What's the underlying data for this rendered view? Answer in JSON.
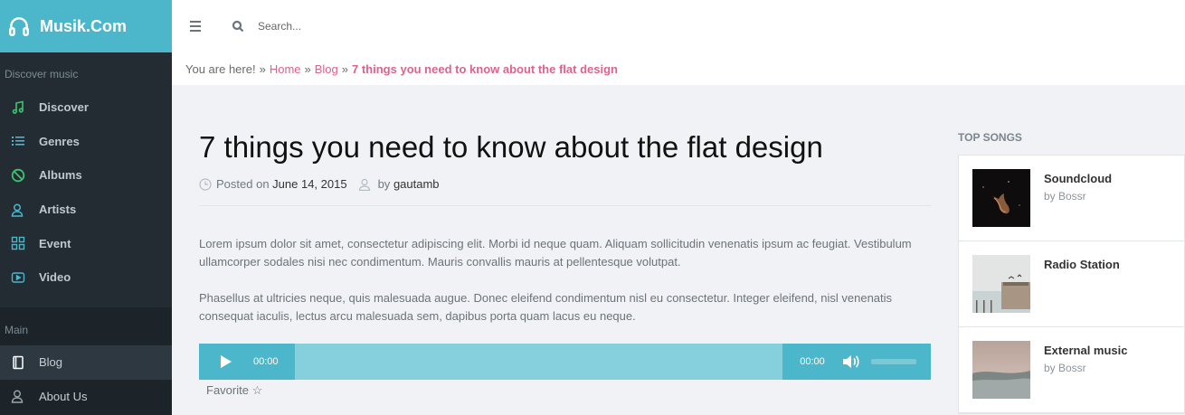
{
  "app": {
    "brand": "Musik.Com"
  },
  "sidebar": {
    "discover_label": "Discover music",
    "discover_items": [
      {
        "label": "Discover",
        "icon": "music-note-icon",
        "color": "#3bc46d"
      },
      {
        "label": "Genres",
        "icon": "list-icon",
        "color": "#4cb6cb"
      },
      {
        "label": "Albums",
        "icon": "disc-icon",
        "color": "#3bc46d"
      },
      {
        "label": "Artists",
        "icon": "user-icon",
        "color": "#4cb6cb"
      },
      {
        "label": "Event",
        "icon": "grid-icon",
        "color": "#4cb6cb"
      },
      {
        "label": "Video",
        "icon": "video-icon",
        "color": "#4cb6cb"
      }
    ],
    "main_label": "Main",
    "main_items": [
      {
        "label": "Blog",
        "icon": "book-icon"
      },
      {
        "label": "About Us",
        "icon": "users-icon"
      }
    ]
  },
  "search": {
    "placeholder": "Search..."
  },
  "breadcrumb": {
    "prefix": "You are here!",
    "sep": "»",
    "home": "Home",
    "blog": "Blog",
    "current": "7 things you need to know about the flat design"
  },
  "post": {
    "title": "7 things you need to know about the flat design",
    "posted_on_label": "Posted on",
    "date": "June 14, 2015",
    "by_label": "by",
    "author": "gautamb",
    "paragraphs": [
      "Lorem ipsum dolor sit amet, consectetur adipiscing elit. Morbi id neque quam. Aliquam sollicitudin venenatis ipsum ac feugiat. Vestibulum ullamcorper sodales nisi nec condimentum. Mauris convallis mauris at pellentesque volutpat.",
      "Phasellus at ultricies neque, quis malesuada augue. Donec eleifend condimentum nisl eu consectetur. Integer eleifend, nisl venenatis consequat iaculis, lectus arcu malesuada sem, dapibus porta quam lacus eu neque."
    ],
    "player": {
      "current_time": "00:00",
      "duration": "00:00"
    },
    "favorite": "Favorite ☆"
  },
  "top_songs": {
    "title": "TOP SONGS",
    "songs": [
      {
        "title": "Soundcloud",
        "artist": "by Bossr"
      },
      {
        "title": "Radio Station",
        "artist": ""
      },
      {
        "title": "External music",
        "artist": "by Bossr"
      }
    ]
  },
  "colors": {
    "accent": "#4cb6cb",
    "link": "#e0618b",
    "sidebar": "#232c32"
  }
}
